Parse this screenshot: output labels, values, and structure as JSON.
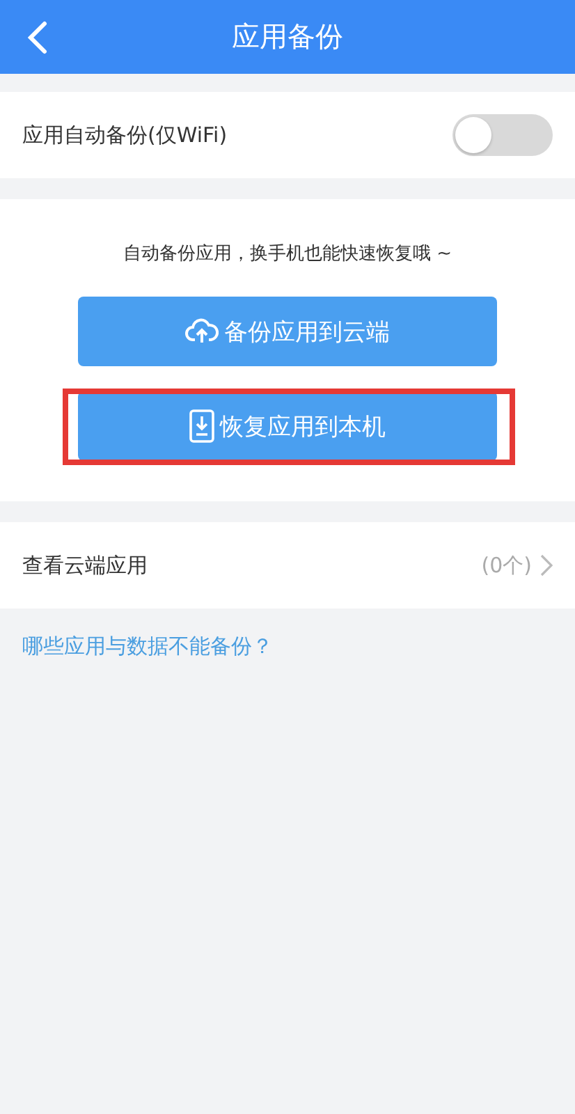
{
  "header": {
    "title": "应用备份"
  },
  "auto_backup": {
    "label": "应用自动备份(仅WiFi)",
    "on": false
  },
  "backup_panel": {
    "hint": "自动备份应用，换手机也能快速恢复哦 ~",
    "buttons": [
      {
        "kind": "upload",
        "label": "备份应用到云端",
        "highlighted": false
      },
      {
        "kind": "download",
        "label": "恢复应用到本机",
        "highlighted": true
      }
    ]
  },
  "cloud_apps": {
    "label": "查看云端应用",
    "count": "(0个)"
  },
  "help_link": "哪些应用与数据不能备份？"
}
